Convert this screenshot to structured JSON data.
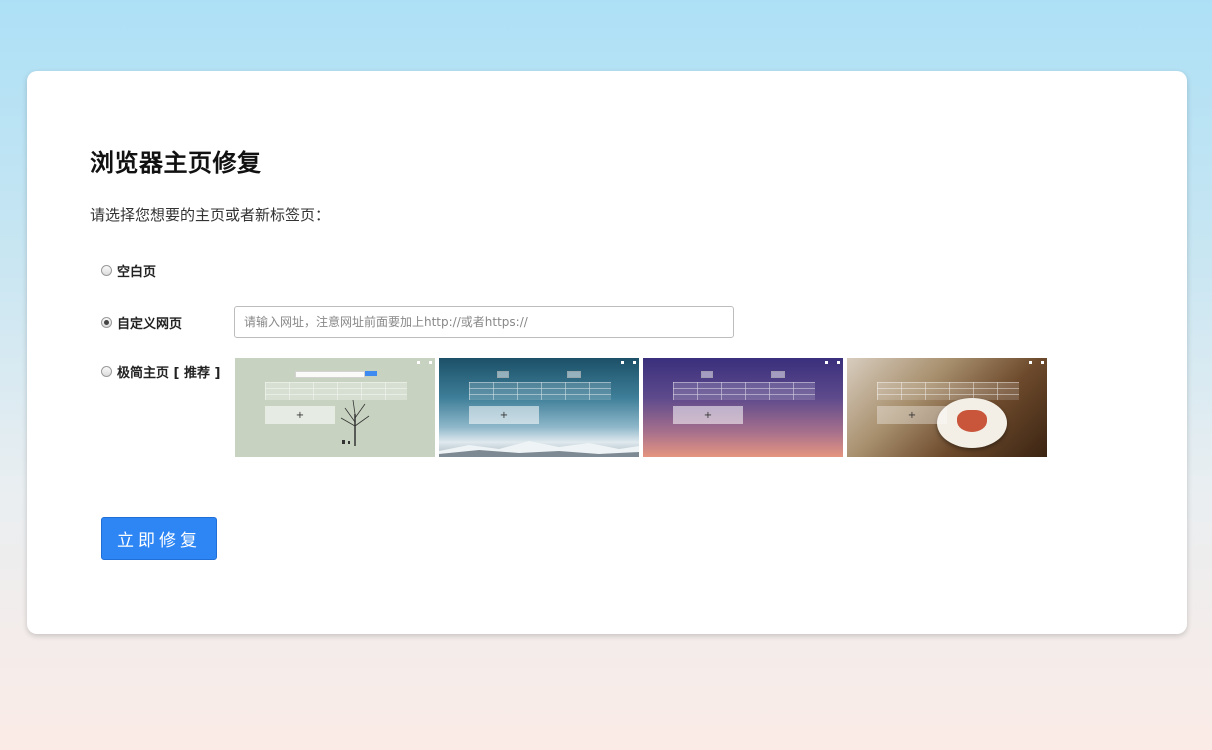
{
  "card": {
    "title": "浏览器主页修复",
    "subtitle": "请选择您想要的主页或者新标签页："
  },
  "options": [
    {
      "label": "空白页",
      "checked": false
    },
    {
      "label": "自定义网页",
      "checked": true
    },
    {
      "label": "极简主页 [ 推荐 ]",
      "checked": false
    }
  ],
  "url_input": {
    "placeholder": "请输入网址，注意网址前面要加上http://或者https://",
    "value": ""
  },
  "thumbnails": [
    {
      "name": "theme-tree"
    },
    {
      "name": "theme-mountain"
    },
    {
      "name": "theme-purple-sunset"
    },
    {
      "name": "theme-coffee"
    }
  ],
  "thumbnail_plus": "+",
  "fix_button": {
    "label": "立即修复"
  },
  "colors": {
    "accent": "#2e86f5",
    "bg_top": "#ade0f6",
    "bg_bottom": "#fbebe6"
  }
}
